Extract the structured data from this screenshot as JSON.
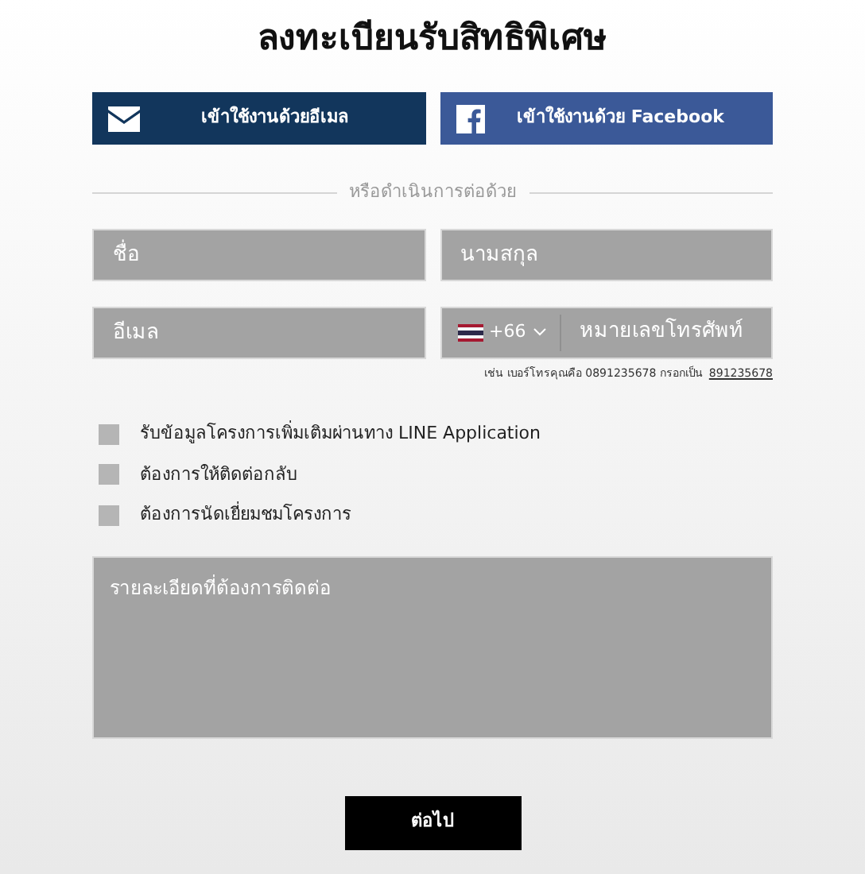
{
  "title": "ลงทะเบียนรับสิทธิพิเศษ",
  "social_buttons": [
    {
      "kind": "email",
      "label": "เข้าใช้งานด้วยอีเมล"
    },
    {
      "kind": "facebook",
      "label": "เข้าใช้งานด้วย Facebook"
    }
  ],
  "divider_text": "หรือดำเนินการต่อด้วย",
  "fields": {
    "first_name": {
      "placeholder": "ชื่อ"
    },
    "last_name": {
      "placeholder": "นามสกุล"
    },
    "email": {
      "placeholder": "อีเมล"
    },
    "phone": {
      "country_code": "+66",
      "placeholder": "หมายเลขโทรศัพท์"
    }
  },
  "phone_hint": {
    "text": "เช่น เบอร์โทรคุณคือ 0891235678 กรอกเป็น",
    "example": "891235678"
  },
  "checkboxes": [
    {
      "label": "รับข้อมูลโครงการเพิ่มเติมผ่านทาง LINE Application",
      "checked": false
    },
    {
      "label": "ต้องการให้ติดต่อกลับ",
      "checked": false
    },
    {
      "label": "ต้องการนัดเยี่ยมชมโครงการ",
      "checked": false
    }
  ],
  "details": {
    "placeholder": "รายละเอียดที่ต้องการติดต่อ"
  },
  "submit_button": "ต่อไป"
}
